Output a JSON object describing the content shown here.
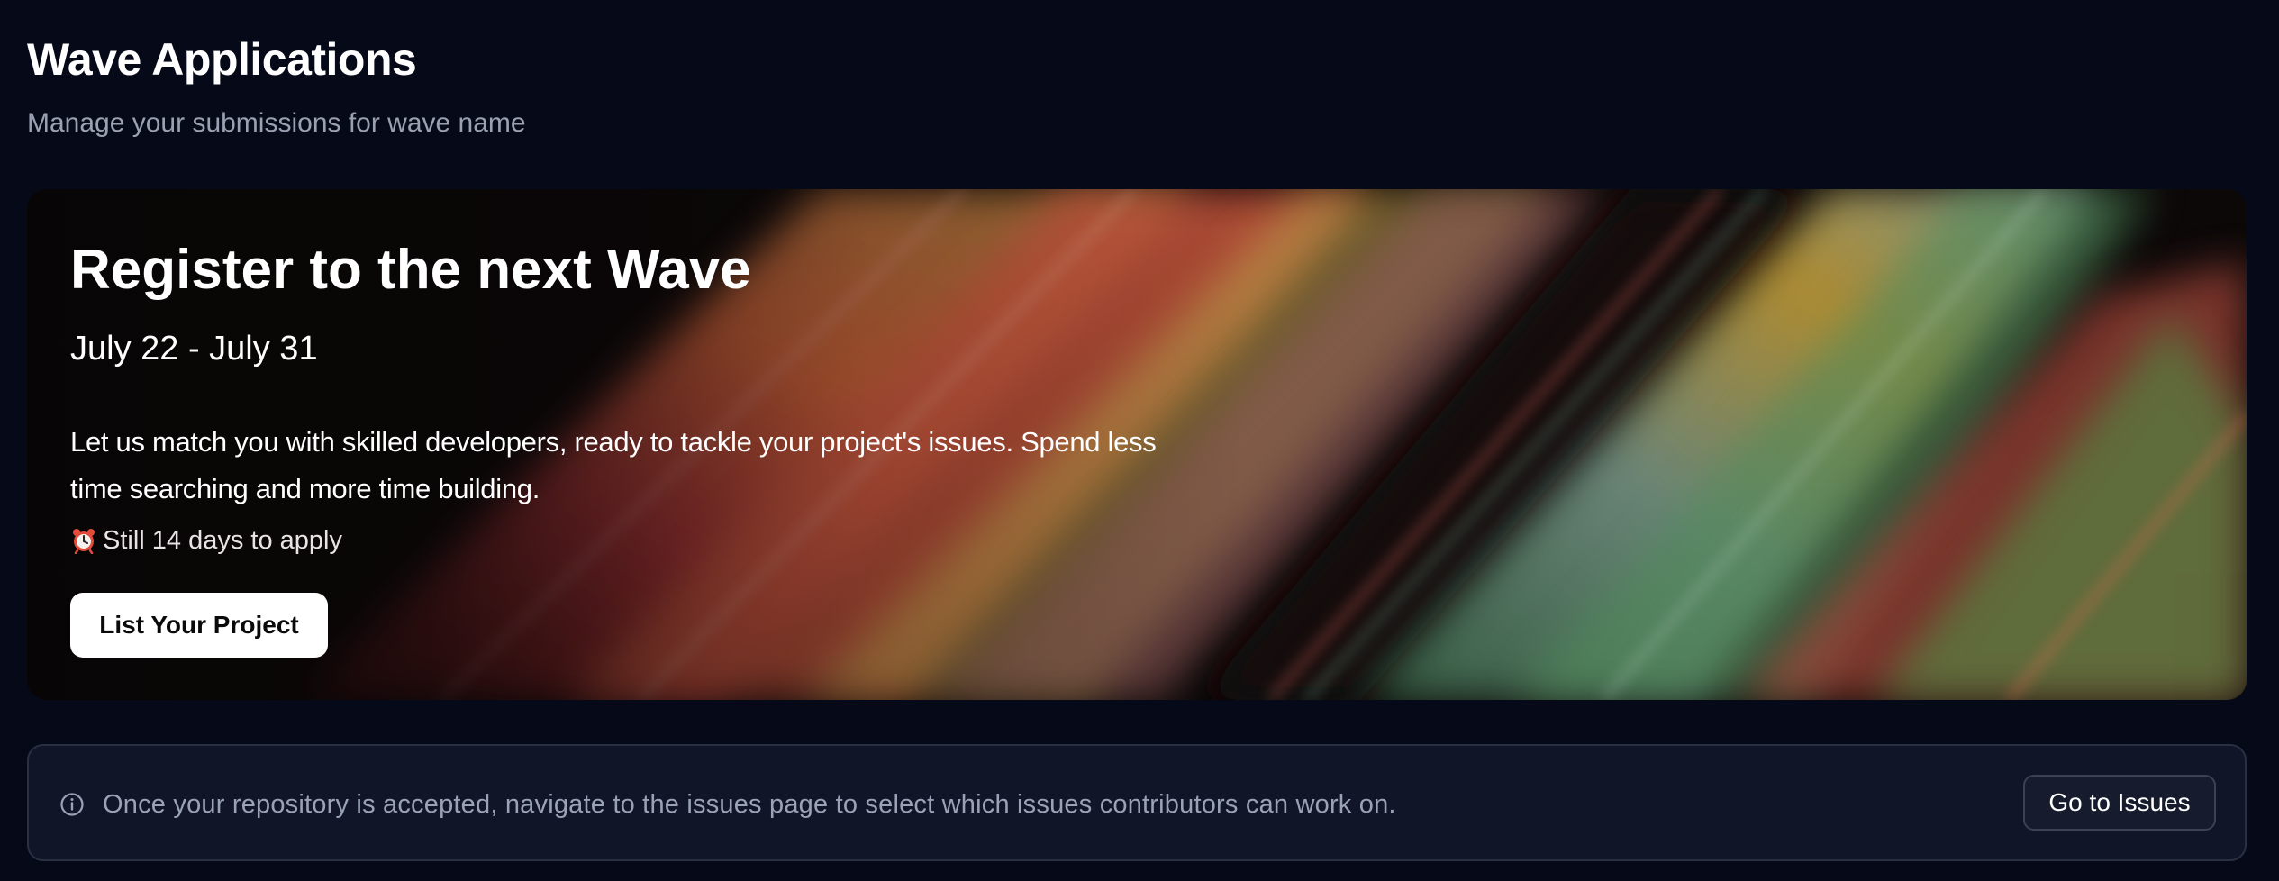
{
  "header": {
    "title": "Wave Applications",
    "subtitle": "Manage your submissions for wave name"
  },
  "banner": {
    "title": "Register to the next Wave",
    "dates": "July 22 - July 31",
    "description": "Let us match you with skilled developers, ready to tackle your project's issues. Spend less time searching and more time building.",
    "countdown": "Still 14 days to apply",
    "countdown_icon": "alarm-clock-icon",
    "cta_label": "List Your Project"
  },
  "info_bar": {
    "icon": "info-circle-icon",
    "message": "Once your repository is accepted, navigate to the issues page to select which issues contributors can work on.",
    "button_label": "Go to Issues"
  },
  "colors": {
    "background": "#060a18",
    "info_bar_background": "#101627",
    "muted_text": "#9aa1b3",
    "button_primary": "#ffffff"
  }
}
